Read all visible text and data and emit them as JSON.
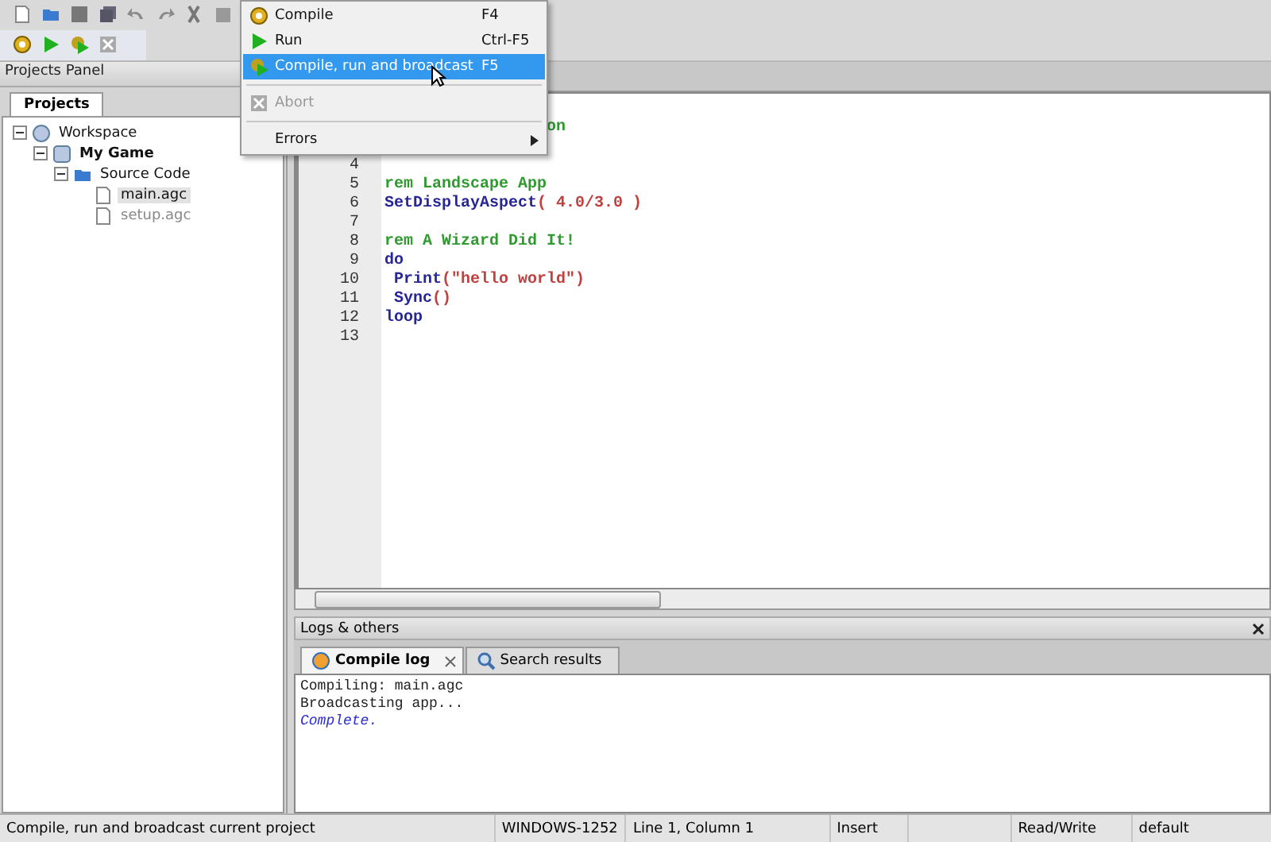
{
  "projects_panel": {
    "title": "Projects Panel",
    "tabs": [
      {
        "label": "Projects",
        "selected": true
      }
    ],
    "tree": [
      {
        "label": "Workspace",
        "kind": "workspace",
        "expanded": true,
        "bold": false,
        "children": [
          {
            "label": "My Game",
            "kind": "project",
            "expanded": true,
            "bold": true,
            "children": [
              {
                "label": "Source Code",
                "kind": "folder",
                "expanded": true,
                "bold": false,
                "children": [
                  {
                    "label": "main.agc",
                    "kind": "file",
                    "selected": true,
                    "disabled": false
                  },
                  {
                    "label": "setup.agc",
                    "kind": "file",
                    "selected": false,
                    "disabled": true
                  }
                ]
              }
            ]
          }
        ]
      }
    ]
  },
  "editor": {
    "lines": [
      {
        "kind": "fragment",
        "tokens": [
          {
            "text": "on",
            "kind": "comment"
          }
        ]
      },
      {
        "kind": "hidden"
      },
      {
        "kind": "code",
        "number": "4"
      },
      {
        "kind": "code",
        "number": "5",
        "tokens": [
          {
            "text": "rem Landscape App",
            "kind": "comment"
          }
        ]
      },
      {
        "kind": "code",
        "number": "6",
        "tokens": [
          {
            "text": "SetDisplayAspect",
            "kind": "keyword"
          },
          {
            "text": "( 4.0/3.0 )",
            "kind": "literal"
          }
        ]
      },
      {
        "kind": "code",
        "number": "7"
      },
      {
        "kind": "code",
        "number": "8",
        "tokens": [
          {
            "text": "rem A Wizard Did It!",
            "kind": "comment"
          }
        ]
      },
      {
        "kind": "code",
        "number": "9",
        "tokens": [
          {
            "text": "do",
            "kind": "keyword"
          }
        ]
      },
      {
        "kind": "code",
        "number": "10",
        "tokens": [
          {
            "text": " Print",
            "kind": "keyword"
          },
          {
            "text": "(\"hello world\")",
            "kind": "literal"
          }
        ]
      },
      {
        "kind": "code",
        "number": "11",
        "tokens": [
          {
            "text": " Sync",
            "kind": "keyword"
          },
          {
            "text": "()",
            "kind": "literal"
          }
        ]
      },
      {
        "kind": "code",
        "number": "12",
        "tokens": [
          {
            "text": "loop",
            "kind": "keyword"
          }
        ]
      },
      {
        "kind": "code",
        "number": "13"
      }
    ]
  },
  "menu": {
    "items": [
      {
        "kind": "item",
        "label": "Compile",
        "shortcut": "F4",
        "selected": false,
        "disabled": false
      },
      {
        "kind": "item",
        "label": "Run",
        "shortcut": "Ctrl-F5",
        "selected": false,
        "disabled": false
      },
      {
        "kind": "item",
        "label": "Compile, run and broadcast",
        "shortcut": "F5",
        "selected": true,
        "disabled": false
      },
      {
        "kind": "separator"
      },
      {
        "kind": "item",
        "label": "Abort",
        "selected": false,
        "disabled": true
      },
      {
        "kind": "separator"
      },
      {
        "kind": "submenu",
        "label": "Errors",
        "selected": false,
        "disabled": false
      }
    ]
  },
  "logs": {
    "title": "Logs & others",
    "tabs": [
      {
        "label": "Compile log",
        "selected": true,
        "closable": true
      },
      {
        "label": "Search results",
        "selected": false,
        "closable": false
      }
    ],
    "lines": [
      {
        "text": "Compiling: main.agc",
        "kind": "normal"
      },
      {
        "text": "Broadcasting app...",
        "kind": "normal"
      },
      {
        "text": "Complete.",
        "kind": "success"
      }
    ]
  },
  "status_bar": [
    {
      "text": "Compile, run and broadcast current project",
      "kind": "message"
    },
    {
      "text": "WINDOWS-1252",
      "kind": "field"
    },
    {
      "text": "Line 1, Column 1",
      "kind": "field"
    },
    {
      "text": "Insert",
      "kind": "field"
    },
    {
      "kind": "empty"
    },
    {
      "text": "Read/Write",
      "kind": "field"
    },
    {
      "text": "default",
      "kind": "field"
    }
  ]
}
